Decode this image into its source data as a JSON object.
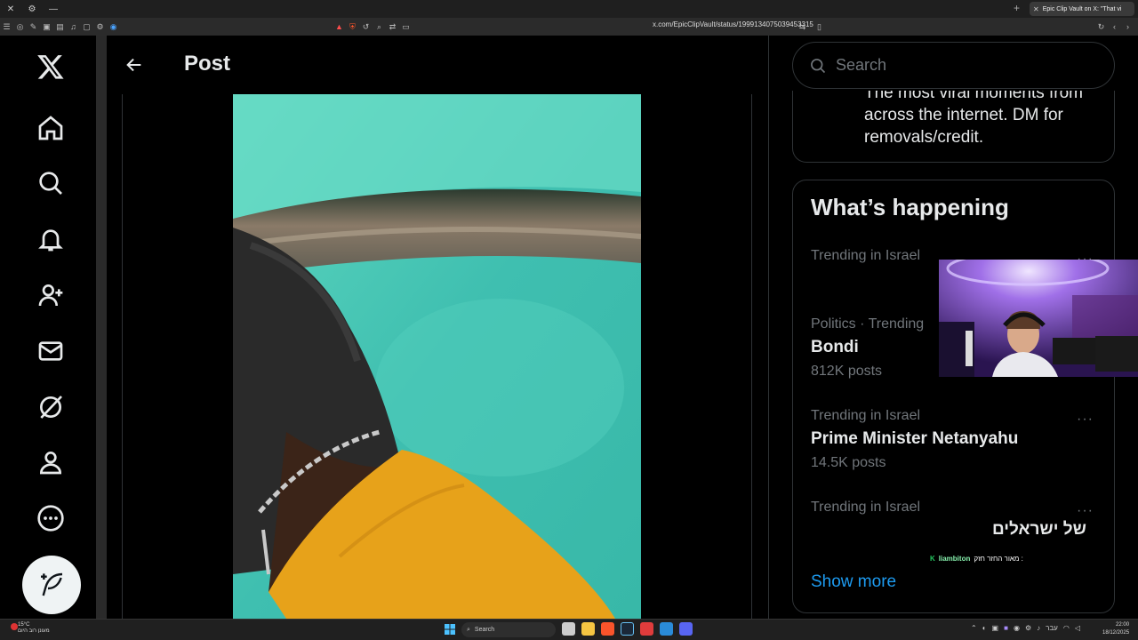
{
  "browser": {
    "tab_title": "Epic Clip Vault on X: \"That vi",
    "url": "x.com/EpicClipVault/status/1999134075039453315",
    "window_controls": [
      "close",
      "settings",
      "minimize"
    ]
  },
  "header": {
    "title": "Post"
  },
  "nav": {
    "items": [
      "x-logo",
      "home",
      "explore",
      "notifications",
      "follow",
      "messages",
      "grok",
      "profile",
      "more"
    ]
  },
  "search": {
    "placeholder": "Search"
  },
  "bio": {
    "text": "The most viral moments from across the internet. DM for removals/credit."
  },
  "happening": {
    "title": "What’s happening",
    "trends": [
      {
        "meta": "Trending in Israel",
        "name": "",
        "count": ""
      },
      {
        "meta": "Politics · Trending",
        "name": "Bondi",
        "count": "812K posts"
      },
      {
        "meta": "Trending in Israel",
        "name": "Prime Minister Netanyahu",
        "count": "14.5K posts"
      },
      {
        "meta": "Trending in Israel",
        "name": "של ישראלים",
        "count": ""
      }
    ],
    "more_label": "···",
    "show_more": "Show more"
  },
  "chat": {
    "badge": "K",
    "user": "liambiton",
    "message": "מאור החזר חזק :"
  },
  "taskbar": {
    "weather_temp": "15°C",
    "weather_desc": "מעונן רוב היום",
    "search": "Search",
    "time": "22:00",
    "date": "18/12/2025",
    "lang": "עבר"
  },
  "colors": {
    "accent": "#1d9bf0",
    "text": "#e7e9ea",
    "muted": "#71767b",
    "border": "#2f3336"
  }
}
